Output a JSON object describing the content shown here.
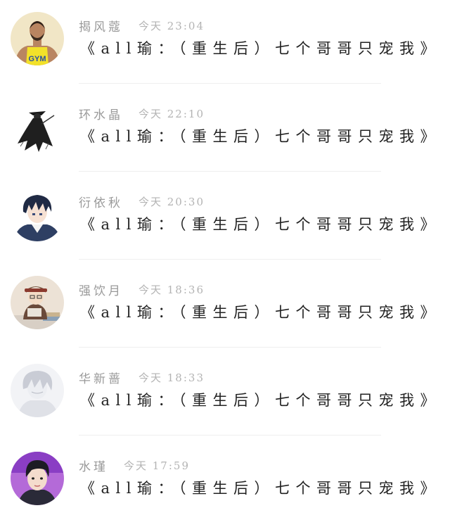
{
  "comments": [
    {
      "username": "揭风蔻",
      "time": "今天 23:04",
      "text": "《all瑜：（重生后）七个哥哥只宠我》",
      "avatar": "gym-man-avatar"
    },
    {
      "username": "环水晶",
      "time": "今天 22:10",
      "text": "《all瑜：（重生后）七个哥哥只宠我》",
      "avatar": "ink-swordsman-avatar"
    },
    {
      "username": "衍依秋",
      "time": "今天 20:30",
      "text": "《all瑜：（重生后）七个哥哥只宠我》",
      "avatar": "anime-boy-avatar"
    },
    {
      "username": "强饮月",
      "time": "今天 18:36",
      "text": "《all瑜：（重生后）七个哥哥只宠我》",
      "avatar": "reading-child-avatar"
    },
    {
      "username": "华新蔷",
      "time": "今天 18:33",
      "text": "《all瑜：（重生后）七个哥哥只宠我》",
      "avatar": "sketch-boy-avatar"
    },
    {
      "username": "水瑾",
      "time": "今天 17:59",
      "text": "《all瑜：（重生后）七个哥哥只宠我》",
      "avatar": "young-man-avatar"
    }
  ]
}
